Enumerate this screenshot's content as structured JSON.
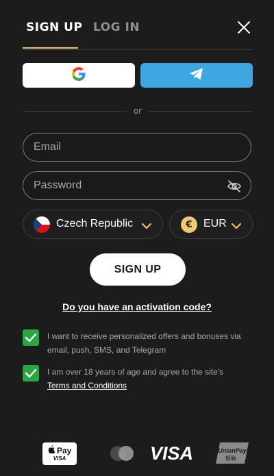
{
  "tabs": {
    "signup": "SIGN UP",
    "login": "LOG IN"
  },
  "divider": {
    "text": "or"
  },
  "email": {
    "placeholder": "Email"
  },
  "password": {
    "placeholder": "Password"
  },
  "country": {
    "value": "Czech Republic"
  },
  "currency": {
    "value": "EUR",
    "symbol": "€"
  },
  "signup_button": "SIGN UP",
  "activation_link": "Do you have an activation code?",
  "checkbox1": {
    "text": "I want to receive personalized offers and bonuses via email, push, SMS, and Telegram",
    "checked": true
  },
  "checkbox2": {
    "text": "I am over 18 years of age and agree to the site's",
    "link": "Terms and Conditions",
    "checked": true
  },
  "payments": {
    "applepay": "Pay",
    "applepay_sub": "VISA",
    "visa": "VISA",
    "unionpay": "UnionPay",
    "unionpay_cn": "银联"
  },
  "colors": {
    "accent": "#e9c27a",
    "telegram": "#3ea6e0",
    "checkbox": "#29a544",
    "background": "#1c1c1c"
  },
  "icons": [
    "close-icon",
    "google-icon",
    "telegram-icon",
    "eye-off-icon",
    "flag-czech-icon",
    "chevron-down-icon",
    "euro-coin-icon",
    "check-icon",
    "apple-icon",
    "mastercard-icon",
    "unionpay-icon"
  ]
}
